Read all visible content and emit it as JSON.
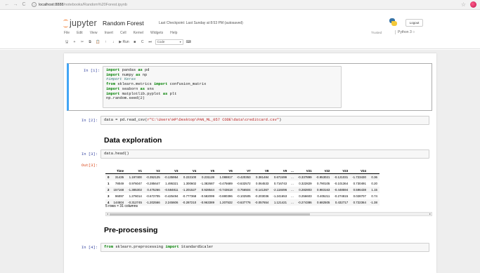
{
  "browser": {
    "url_host": "localhost:8888",
    "url_path": "/notebooks/Random%20Forest.ipynb",
    "back_icon": "←",
    "forward_icon": "→",
    "reload_icon": "C"
  },
  "header": {
    "logo_text": "jupyter",
    "notebook_title": "Random Forest",
    "checkpoint": "Last Checkpoint: Last Sunday at 8:53 PM  (autosaved)",
    "logout_label": "Logout",
    "trusted_label": "Trusted",
    "kernel_label": "Python 3 ○"
  },
  "menu": [
    "File",
    "Edit",
    "View",
    "Insert",
    "Cell",
    "Kernel",
    "Widgets",
    "Help"
  ],
  "toolbar": {
    "buttons": [
      "🖫",
      "+",
      "✂",
      "⧉",
      "📋",
      "↑",
      "↓",
      "▶ Run",
      "■",
      "C",
      "⏭"
    ],
    "cell_type": "Code",
    "keyboard_icon": "⌨"
  },
  "cells": {
    "c1_prompt": "In [1]:",
    "c2_prompt": "In [2]:",
    "c2_code_prefix": "data = pd.read_csv(",
    "c2_code_string": "r\"C:\\Users\\HP\\Desktop\\PAN_ML_057 CODE\\data\\creditcard.csv\"",
    "c2_code_suffix": ")",
    "md1": "Data exploration",
    "c3_prompt": "In [3]:",
    "c3_code": "data.head()",
    "out3_prompt": "Out[3]:",
    "md2": "Pre-processing",
    "c4_prompt": "In [4]:",
    "c4_code_tail": "StandardScaler"
  },
  "dataframe": {
    "columns": [
      "",
      "Time",
      "V1",
      "V2",
      "V3",
      "V4",
      "V5",
      "V6",
      "V7",
      "V8",
      "V9",
      "...",
      "V21",
      "V22",
      "V23",
      "V24"
    ],
    "rows": [
      [
        "0",
        "31435",
        "1.197400",
        "-0.352125",
        "-0.135954",
        "0.222100",
        "0.231128",
        "1.088817",
        "-0.420353",
        "0.381484",
        "0.672499",
        "...",
        "-0.337899",
        "-0.953021",
        "-0.121031",
        "-1.723430",
        "0.36"
      ],
      [
        "1",
        "78049",
        "0.976047",
        "-0.285647",
        "1.495321",
        "1.300602",
        "-1.382687",
        "-0.475689",
        "-0.632572",
        "0.064533",
        "0.716743",
        "...",
        "0.322829",
        "0.790105",
        "-0.101364",
        "0.730491",
        "0.20"
      ],
      [
        "2",
        "157168",
        "-1.385302",
        "0.475266",
        "-0.584811",
        "-1.201527",
        "0.928544",
        "-0.743618",
        "0.756504",
        "-0.141367",
        "-2.118496",
        "...",
        "0.282803",
        "0.983163",
        "-0.448594",
        "0.596438",
        "1.15"
      ],
      [
        "3",
        "96097",
        "1.276014",
        "-0.672705",
        "-0.425494",
        "-0.777368",
        "-0.582099",
        "-0.880396",
        "-0.102505",
        "-0.203036",
        "-1.241653",
        "...",
        "0.256603",
        "0.405211",
        "-0.274815",
        "0.028707",
        "0.74"
      ],
      [
        "4",
        "144504",
        "-0.312745",
        "-1.202566",
        "2.245606",
        "-0.287210",
        "-0.963389",
        "1.207532",
        "-0.637776",
        "-0.057654",
        "1.121421",
        "...",
        "-0.274386",
        "0.682505",
        "0.432717",
        "0.722364",
        "-1.38"
      ]
    ],
    "footer": "5 rows × 31 columns"
  }
}
